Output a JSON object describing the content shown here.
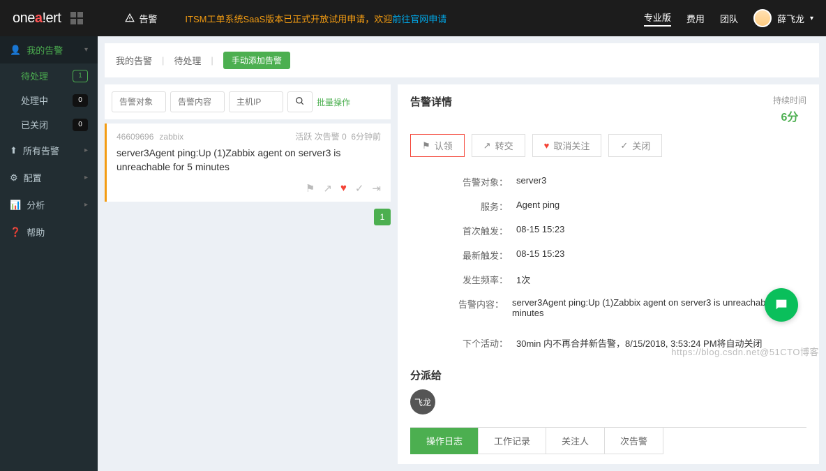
{
  "brand": {
    "name_pre": "one",
    "name_accent": "a",
    "name_post": "!ert"
  },
  "topnav": {
    "alert_label": "告警",
    "banner_pre": "ITSM工单系统SaaS版本已正式开放试用申请，欢迎",
    "banner_link": "前往官网申请",
    "links": {
      "pro": "专业版",
      "fee": "费用",
      "team": "团队"
    },
    "username": "薛飞龙"
  },
  "sidebar": {
    "my_alerts": "我的告警",
    "pending": "待处理",
    "pending_count": "1",
    "processing": "处理中",
    "processing_count": "0",
    "closed": "已关闭",
    "closed_count": "0",
    "all_alerts": "所有告警",
    "config": "配置",
    "analysis": "分析",
    "help": "帮助"
  },
  "crumbs": {
    "my": "我的告警",
    "pending": "待处理",
    "manual_add": "手动添加告警"
  },
  "filters": {
    "obj_placeholder": "告警对象",
    "content_placeholder": "告警内容",
    "host_placeholder": "主机IP",
    "bulk": "批量操作"
  },
  "alert_card": {
    "id": "46609696",
    "source": "zabbix",
    "status_label": "活跃 次告警",
    "count": "0",
    "ago": "6分钟前",
    "title": "server3Agent ping:Up (1)Zabbix agent on server3 is unreachable for 5 minutes",
    "page": "1"
  },
  "detail": {
    "title": "告警详情",
    "duration_label": "持续时间",
    "duration_value": "6分",
    "actions": {
      "claim": "认领",
      "transfer": "转交",
      "unfollow": "取消关注",
      "close": "关闭"
    },
    "fields": {
      "obj_label": "告警对象：",
      "obj_val": "server3",
      "svc_label": "服务：",
      "svc_val": "Agent ping",
      "first_label": "首次触发：",
      "first_val": "08-15 15:23",
      "latest_label": "最新触发：",
      "latest_val": "08-15 15:23",
      "freq_label": "发生频率：",
      "freq_val": "1次",
      "content_label": "告警内容：",
      "content_val": "server3Agent ping:Up (1)Zabbix agent on server3 is unreachable for 5 minutes",
      "next_label": "下个活动：",
      "next_val": "30min 内不再合并新告警，8/15/2018, 3:53:24 PM将自动关闭"
    },
    "assign_title": "分派给",
    "assignee": "飞龙",
    "tabs": {
      "log": "操作日志",
      "work": "工作记录",
      "followers": "关注人",
      "secondary": "次告警"
    }
  },
  "watermark": "https://blog.csdn.net@51CTO博客"
}
